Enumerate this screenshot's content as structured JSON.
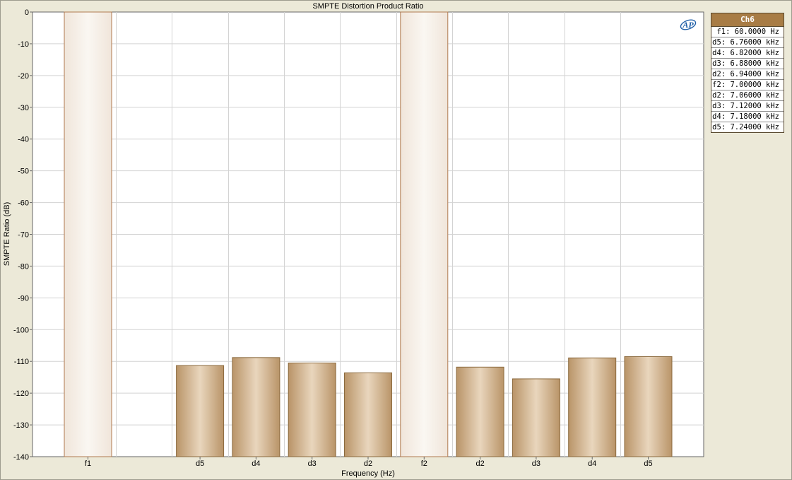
{
  "chart_data": {
    "type": "bar",
    "title": "SMPTE Distortion Product Ratio",
    "xlabel": "Frequency (Hz)",
    "ylabel": "SMPTE Ratio (dB)",
    "ylim": [
      -140,
      0
    ],
    "yticks": [
      0,
      -10,
      -20,
      -30,
      -40,
      -50,
      -60,
      -70,
      -80,
      -90,
      -100,
      -110,
      -120,
      -130,
      -140
    ],
    "grid": true,
    "categories": [
      "f1",
      "",
      "d5",
      "d4",
      "d3",
      "d2",
      "f2",
      "d2",
      "d3",
      "d4",
      "d5"
    ],
    "series": [
      {
        "name": "Ch6",
        "values": [
          0,
          null,
          -111.3,
          -108.8,
          -110.5,
          -113.6,
          0,
          -111.8,
          -115.5,
          -108.9,
          -108.5
        ],
        "kinds": [
          "fundamental",
          "gap",
          "product",
          "product",
          "product",
          "product",
          "fundamental",
          "product",
          "product",
          "product",
          "product"
        ]
      }
    ],
    "legend": {
      "placement": "right",
      "header": "Ch6",
      "entries": [
        "f1: 60.0000 Hz",
        "d5: 6.76000 kHz",
        "d4: 6.82000 kHz",
        "d3: 6.88000 kHz",
        "d2: 6.94000 kHz",
        "f2: 7.00000 kHz",
        "d2: 7.06000 kHz",
        "d3: 7.12000 kHz",
        "d4: 7.18000 kHz",
        "d5: 7.24000 kHz"
      ]
    }
  },
  "logo_text": "AP",
  "colors": {
    "bar_edge": "#8b6a3e",
    "bar_center": "#e9d6bd",
    "bar_side": "#b99468",
    "fundamental_edge": "#b07a50",
    "fundamental_center": "#faf7f2",
    "fundamental_side": "#f0e5da",
    "grid": "#d3d3d3",
    "logo": "#1f5fa8"
  }
}
